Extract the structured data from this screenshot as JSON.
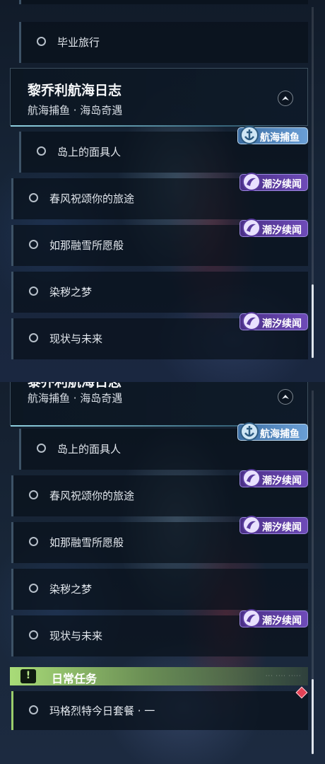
{
  "top": {
    "prev_item": "毕业旅行",
    "header": {
      "title": "黎乔利航海日志",
      "subtitle": "航海捕鱼 · 海岛奇遇"
    },
    "items": [
      {
        "label": "岛上的面具人",
        "tag": "航海捕鱼",
        "tag_color": "#5b8fc8"
      },
      {
        "label": "春风祝颂你的旅途",
        "tag": "潮汐续闻",
        "tag_color": "#5a3c9e"
      },
      {
        "label": "如那融雪所愿般",
        "tag": "潮汐续闻",
        "tag_color": "#5a3c9e"
      },
      {
        "label": "染秽之梦"
      },
      {
        "label": "现状与未来",
        "tag": "潮汐续闻",
        "tag_color": "#5a3c9e"
      }
    ]
  },
  "bottom": {
    "header": {
      "title": "黎乔利航海日志",
      "subtitle": "航海捕鱼 · 海岛奇遇"
    },
    "items": [
      {
        "label": "岛上的面具人",
        "tag": "航海捕鱼"
      },
      {
        "label": "春风祝颂你的旅途",
        "tag": "潮汐续闻"
      },
      {
        "label": "如那融雪所愿般",
        "tag": "潮汐续闻"
      },
      {
        "label": "染秽之梦"
      },
      {
        "label": "现状与未来",
        "tag": "潮汐续闻"
      }
    ],
    "section": {
      "title": "日常任务",
      "icon": "!"
    },
    "daily_item": {
      "label": "玛格烈特今日套餐 · 一"
    }
  },
  "icons": {
    "collapse": "chevron-up-icon",
    "circle": "status-circle-icon",
    "section": "alert-icon",
    "badge": "diamond-icon"
  },
  "colors": {
    "accent_green": "#9bcd6b",
    "badge_red": "#e34256"
  }
}
